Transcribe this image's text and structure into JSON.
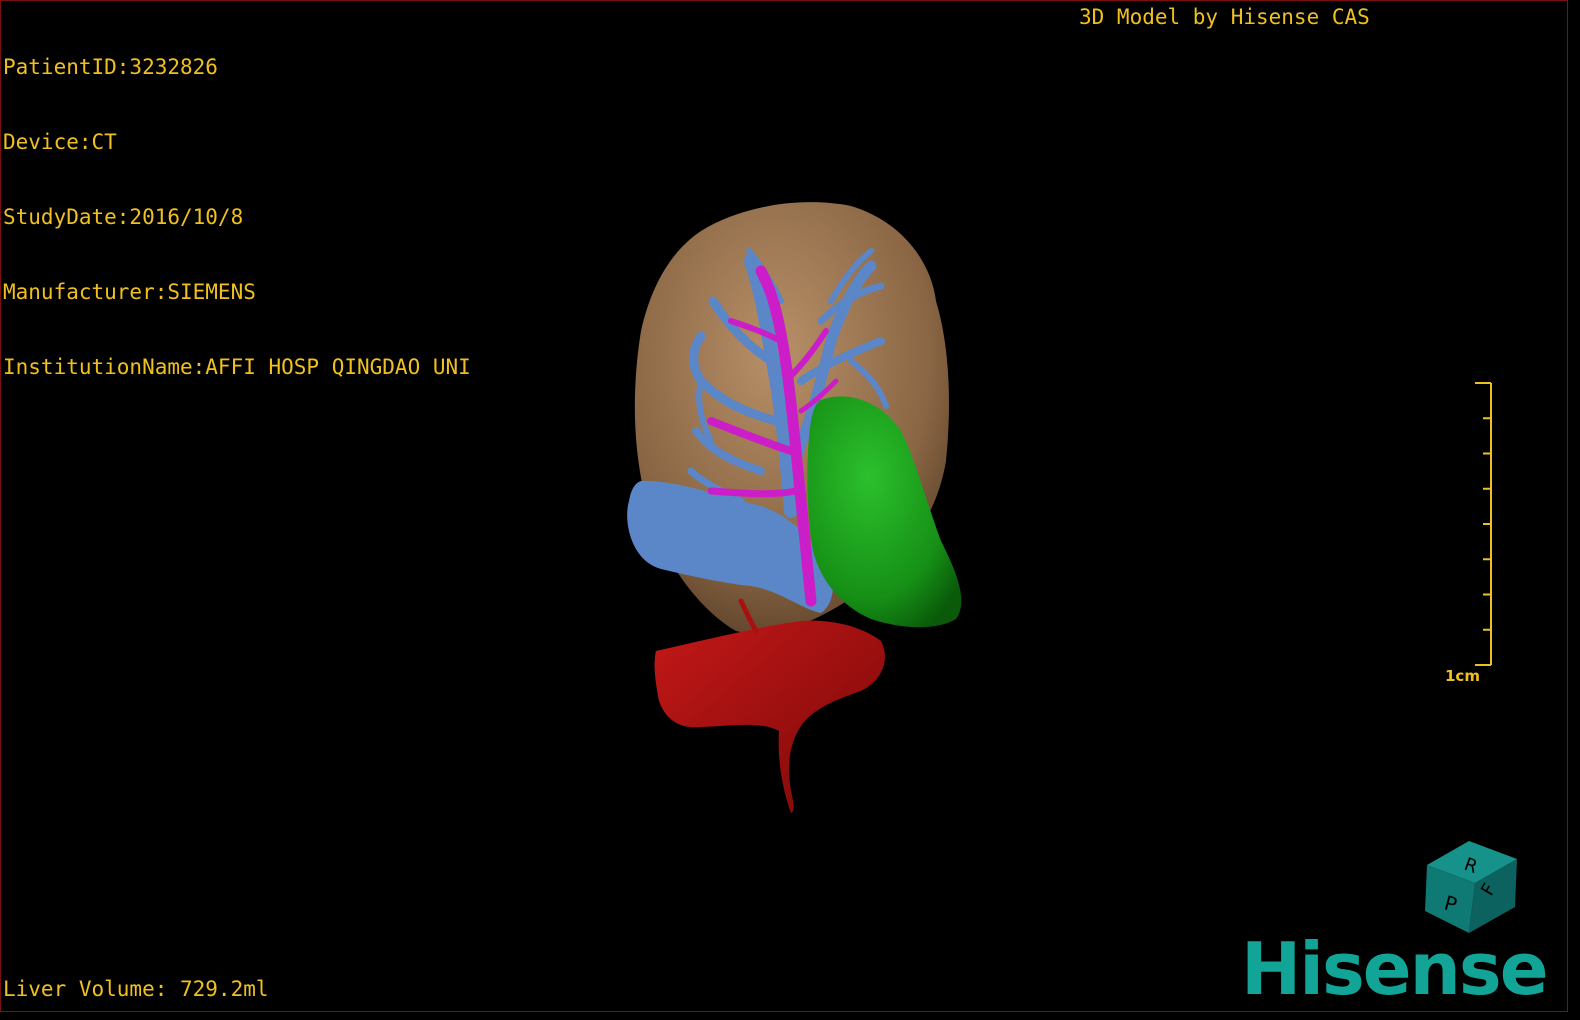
{
  "patient": {
    "id_line": "PatientID:3232826",
    "device_line": "Device:CT",
    "study_date_line": "StudyDate:2016/10/8",
    "manufacturer_line": "Manufacturer:SIEMENS",
    "institution_line": "InstitutionName:AFFI HOSP QINGDAO UNI"
  },
  "credit": "3D Model by Hisense CAS",
  "liver_volume_line": "Liver Volume: 729.2ml",
  "scale": {
    "label": "1cm",
    "ticks": 8
  },
  "orientation_cube": {
    "face_labels": [
      "R",
      "F",
      "P"
    ],
    "color": "#0f7a74"
  },
  "brand": "Hisense",
  "colors": {
    "overlay_text": "#f0c020",
    "liver": "#9a7550",
    "portal_vein": "#5b86c8",
    "hepatic_artery": "#cc1ec8",
    "gallbladder_or_kidney": "#1fa21f",
    "vessel_red": "#aa1010",
    "brand": "#12a597"
  }
}
